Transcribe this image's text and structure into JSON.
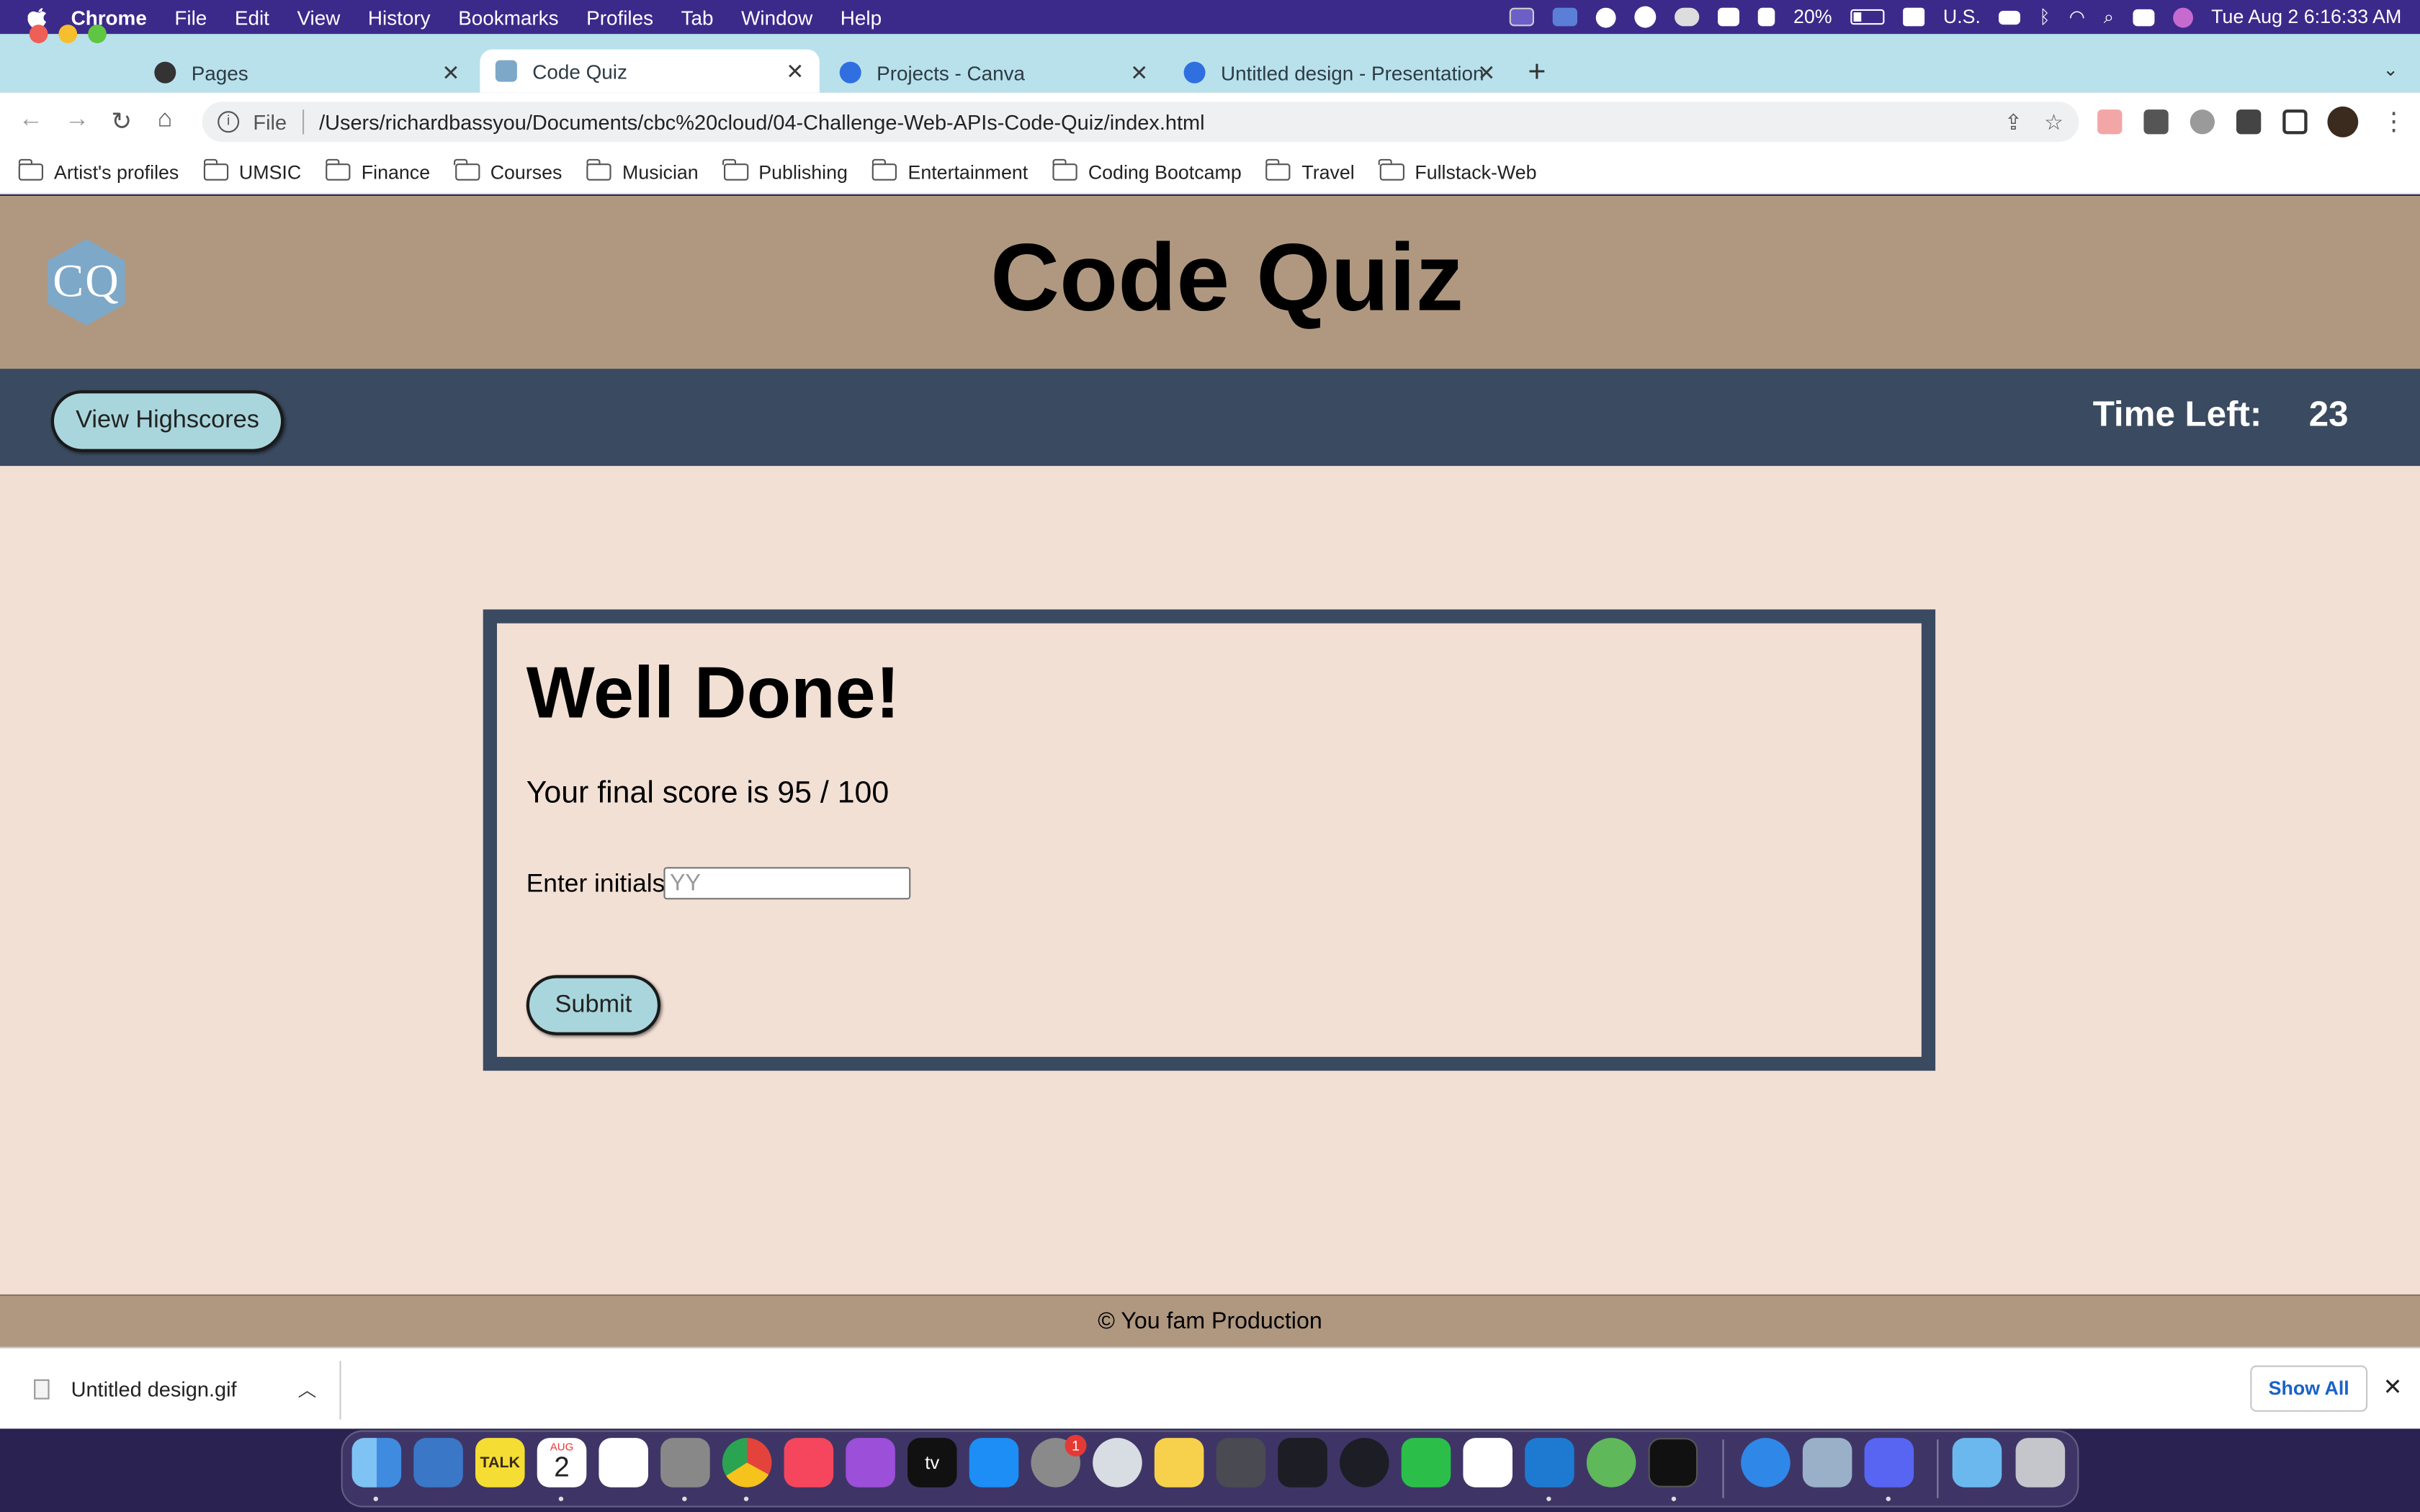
{
  "menubar": {
    "app": "Chrome",
    "items": [
      "File",
      "Edit",
      "View",
      "History",
      "Bookmarks",
      "Profiles",
      "Tab",
      "Window",
      "Help"
    ],
    "battery": "20%",
    "input_source": "U.S.",
    "clock": "Tue Aug 2  6:16:33 AM"
  },
  "tabs": [
    {
      "title": "Pages",
      "icon": "github-icon"
    },
    {
      "title": "Code Quiz",
      "icon": "cq-favicon-icon"
    },
    {
      "title": "Projects - Canva",
      "icon": "canva-icon"
    },
    {
      "title": "Untitled design - Presentation",
      "icon": "canva-icon"
    }
  ],
  "omnibox": {
    "scheme": "File",
    "url": "/Users/richardbassyou/Documents/cbc%20cloud/04-Challenge-Web-APIs-Code-Quiz/index.html"
  },
  "bookmarks": [
    "Artist's profiles",
    "UMSIC",
    "Finance",
    "Courses",
    "Musician",
    "Publishing",
    "Entertainment",
    "Coding Bootcamp",
    "Travel",
    "Fullstack-Web"
  ],
  "page": {
    "logo_text": "CQ",
    "title": "Code Quiz",
    "highscores_button": "View Highscores",
    "time_label": "Time Left:",
    "time_value": "23",
    "card": {
      "heading": "Well Done!",
      "score_text": "Your final score is 95 / 100",
      "initials_label": "Enter initials:",
      "initials_placeholder": "YY",
      "submit_label": "Submit"
    },
    "footer": "© You fam Production"
  },
  "downloads": {
    "file_name": "Untitled design.gif",
    "show_all": "Show All"
  },
  "dock": {
    "calendar_month": "AUG",
    "calendar_day": "2",
    "badge": "1",
    "talk_label": "TALK",
    "tv_label": "tv"
  },
  "colors": {
    "header_bg": "#b09880",
    "nav_bg": "#3a4a60",
    "page_bg": "#f2e0d5",
    "button_bg": "#a9d6dc"
  }
}
